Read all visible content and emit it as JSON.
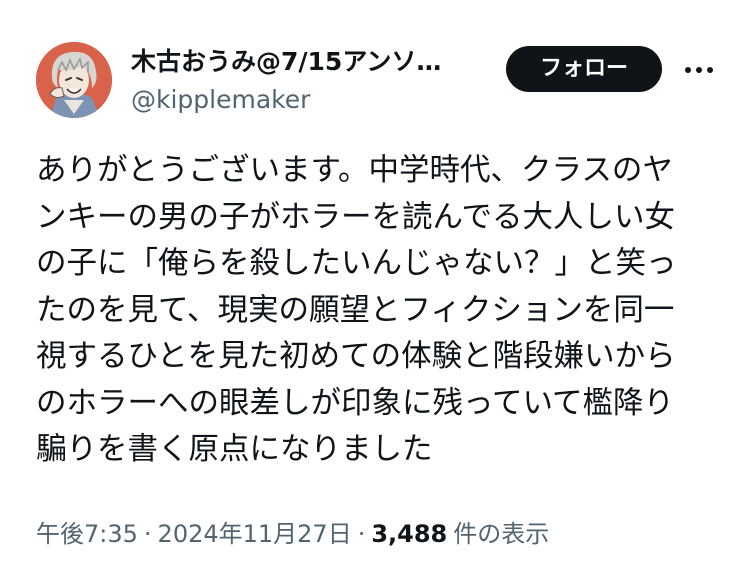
{
  "author": {
    "display_name": "木古おうみ@7/15アンソ…",
    "handle": "@kipplemaker",
    "avatar_icon": "avatar-illustration-icon"
  },
  "actions": {
    "follow_label": "フォロー",
    "more_icon": "more-horizontal-icon"
  },
  "tweet": {
    "lines": [
      "ありがとうございます。中学時代、クラスのヤ",
      "ンキーの男の子がホラーを読んでる大人しい女",
      "の子に「俺らを殺したいんじゃない？」と笑っ",
      "たのを見て、現実の願望とフィクションを同一",
      "視するひとを見た初めての体験と階段嫌いから",
      "のホラーへの眼差しが印象に残っていて檻降り",
      "騙りを書く原点になりました"
    ]
  },
  "meta": {
    "time": "午後7:35",
    "separator": "·",
    "date": "2024年11月27日",
    "views_count": "3,488",
    "views_label": "件の表示"
  },
  "colors": {
    "text": "#0f1419",
    "secondary": "#536471",
    "button_bg": "#0f1419",
    "button_text": "#ffffff",
    "avatar_bg": "#d9634a"
  }
}
